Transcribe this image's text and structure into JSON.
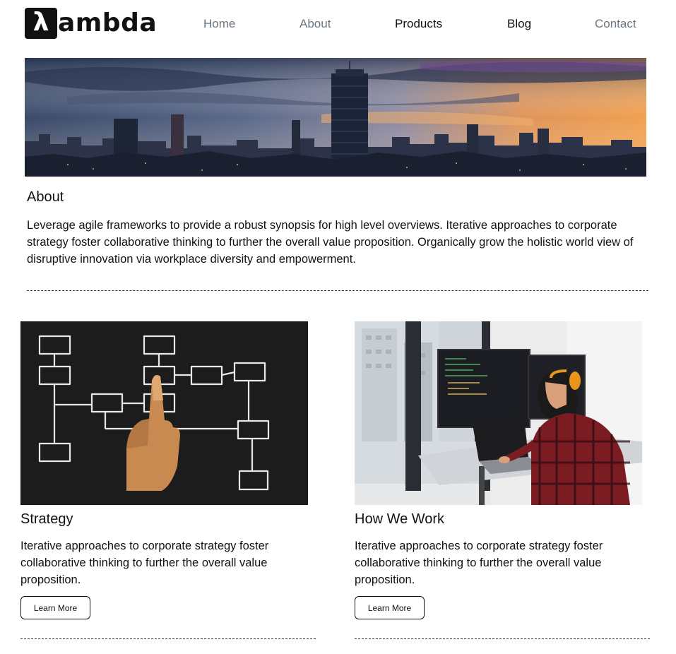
{
  "brand": {
    "logo_mark": "λ",
    "logo_text": "ambda"
  },
  "nav": {
    "items": [
      {
        "label": "Home"
      },
      {
        "label": "About"
      },
      {
        "label": "Products"
      },
      {
        "label": "Blog"
      },
      {
        "label": "Contact"
      }
    ]
  },
  "hero": {
    "image": "city-skyline-sunset"
  },
  "about": {
    "title": "About",
    "body": "Leverage agile frameworks to provide a robust synopsis for high level overviews. Iterative approaches to corporate strategy foster collaborative thinking to further the overall value proposition. Organically grow the holistic world view of disruptive innovation via workplace diversity and empowerment."
  },
  "cards": [
    {
      "image": "flowchart-chalkboard-hand",
      "title": "Strategy",
      "body": "Iterative approaches to corporate strategy foster collaborative thinking to further the overall value proposition.",
      "button": "Learn More"
    },
    {
      "image": "woman-coding-at-monitors",
      "title": "How We Work",
      "body": "Iterative approaches to corporate strategy foster collaborative thinking to further the overall value proposition.",
      "button": "Learn More"
    }
  ],
  "colors": {
    "nav_muted": "#6a7680",
    "text": "#111111",
    "chalkboard": "#1c1c1c"
  }
}
